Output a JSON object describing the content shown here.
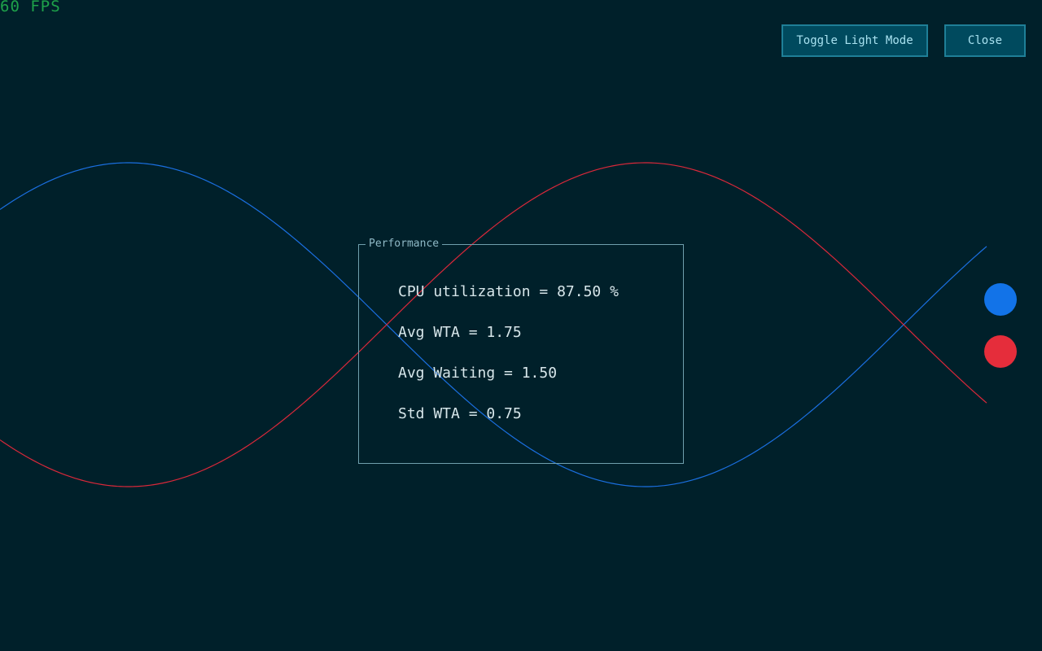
{
  "fps": "60 FPS",
  "buttons": {
    "toggle_light_mode": "Toggle Light Mode",
    "close": "Close"
  },
  "panel": {
    "title": "Performance",
    "metrics": [
      "CPU utilization = 87.50 %",
      "Avg WTA = 1.75",
      "Avg Waiting = 1.50",
      "Std WTA = 0.75"
    ]
  },
  "colors": {
    "background": "#00202a",
    "blue_wave": "#1a6fe0",
    "red_wave": "#d9283a",
    "blue_dot": "#1273e8",
    "red_dot": "#e52d3b",
    "fps_text": "#1ea24a"
  }
}
